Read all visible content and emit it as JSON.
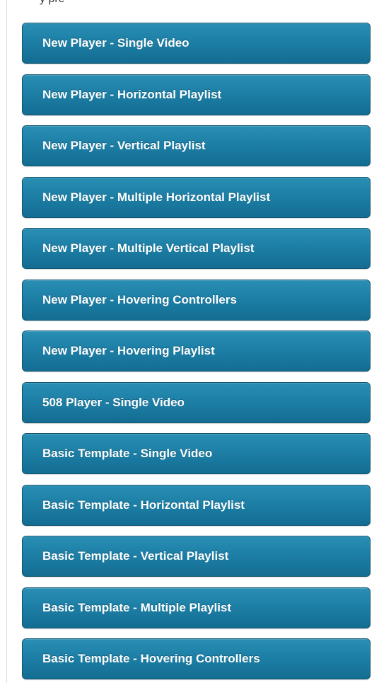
{
  "header": {
    "partial_text": "y pre"
  },
  "buttons": [
    {
      "label": "New Player - Single Video"
    },
    {
      "label": "New Player - Horizontal Playlist"
    },
    {
      "label": "New Player - Vertical Playlist"
    },
    {
      "label": "New Player - Multiple Horizontal Playlist"
    },
    {
      "label": "New Player - Multiple Vertical Playlist"
    },
    {
      "label": "New Player - Hovering Controllers"
    },
    {
      "label": "New Player - Hovering Playlist"
    },
    {
      "label": "508 Player - Single Video"
    },
    {
      "label": "Basic Template - Single Video"
    },
    {
      "label": "Basic Template - Horizontal Playlist"
    },
    {
      "label": "Basic Template - Vertical Playlist"
    },
    {
      "label": "Basic Template - Multiple Playlist"
    },
    {
      "label": "Basic Template - Hovering Controllers"
    }
  ],
  "colors": {
    "button_top": "#2a8fb4",
    "button_bottom": "#146d92",
    "button_border": "#0f5470",
    "button_text": "#ffffff"
  }
}
